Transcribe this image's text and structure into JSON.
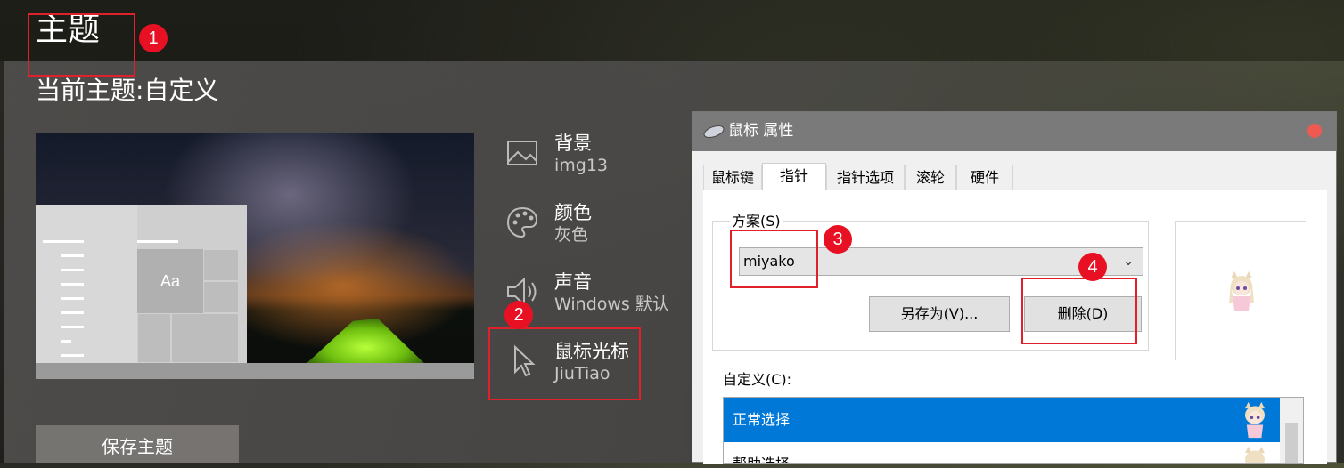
{
  "page": {
    "title": "主题",
    "current_theme": "当前主题:自定义",
    "save_button": "保存主题"
  },
  "settings": [
    {
      "label": "背景",
      "value": "img13",
      "icon": "image-icon"
    },
    {
      "label": "颜色",
      "value": "灰色",
      "icon": "palette-icon"
    },
    {
      "label": "声音",
      "value": "Windows 默认",
      "icon": "speaker-icon"
    },
    {
      "label": "鼠标光标",
      "value": "JiuTiao",
      "icon": "cursor-icon"
    }
  ],
  "preview": {
    "sample_text": "Aa"
  },
  "annotations": [
    "1",
    "2",
    "3",
    "4"
  ],
  "dialog": {
    "title": "鼠标 属性",
    "tabs": [
      "鼠标键",
      "指针",
      "指针选项",
      "滚轮",
      "硬件"
    ],
    "active_tab": "指针",
    "scheme_label": "方案(S)",
    "scheme_value": "miyako",
    "save_as_button": "另存为(V)...",
    "delete_button": "删除(D)",
    "customize_label": "自定义(C):",
    "list_items": [
      "正常选择",
      "帮助选择"
    ]
  },
  "colors": {
    "accent": "#0078d7",
    "annotation": "#e81123"
  }
}
